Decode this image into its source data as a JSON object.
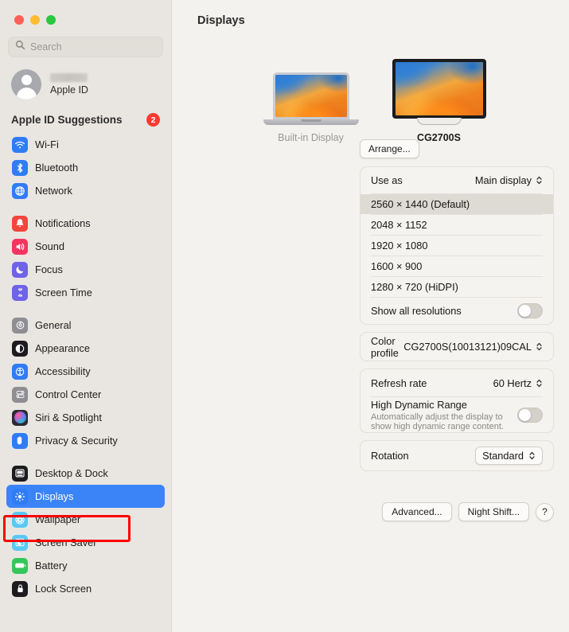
{
  "window": {
    "traffic_lights": [
      "close",
      "minimize",
      "zoom"
    ]
  },
  "sidebar": {
    "search": {
      "placeholder": "Search",
      "value": ""
    },
    "account": {
      "name_redacted": true,
      "subtitle": "Apple ID"
    },
    "suggestions": {
      "title": "Apple ID Suggestions",
      "badge": "2"
    },
    "groups": [
      {
        "items": [
          {
            "label": "Wi-Fi",
            "icon": "wifi-icon",
            "color": "#2f7cf6"
          },
          {
            "label": "Bluetooth",
            "icon": "bluetooth-icon",
            "color": "#2f7cf6"
          },
          {
            "label": "Network",
            "icon": "network-globe-icon",
            "color": "#2f7cf6"
          }
        ]
      },
      {
        "items": [
          {
            "label": "Notifications",
            "icon": "notifications-bell-icon",
            "color": "#f4453c"
          },
          {
            "label": "Sound",
            "icon": "sound-speaker-icon",
            "color": "#f5355f"
          },
          {
            "label": "Focus",
            "icon": "focus-moon-icon",
            "color": "#6f63e8"
          },
          {
            "label": "Screen Time",
            "icon": "screen-time-hourglass-icon",
            "color": "#6f63e8"
          }
        ]
      },
      {
        "items": [
          {
            "label": "General",
            "icon": "general-gear-icon",
            "color": "#8e8e93"
          },
          {
            "label": "Appearance",
            "icon": "appearance-contrast-icon",
            "color": "#1c1c1e"
          },
          {
            "label": "Accessibility",
            "icon": "accessibility-person-icon",
            "color": "#2f7cf6"
          },
          {
            "label": "Control Center",
            "icon": "control-center-icon",
            "color": "#8e8e93"
          },
          {
            "label": "Siri & Spotlight",
            "icon": "siri-orb-icon",
            "color": "#2b2b33"
          },
          {
            "label": "Privacy & Security",
            "icon": "privacy-hand-icon",
            "color": "#2f7cf6"
          }
        ]
      },
      {
        "items": [
          {
            "label": "Desktop & Dock",
            "icon": "desktop-dock-icon",
            "color": "#1c1c1e"
          },
          {
            "label": "Displays",
            "icon": "displays-brightness-icon",
            "color": "#2f7cf6",
            "selected": true
          },
          {
            "label": "Wallpaper",
            "icon": "wallpaper-flower-icon",
            "color": "#5ac8f5"
          },
          {
            "label": "Screen Saver",
            "icon": "screen-saver-icon",
            "color": "#5ac8f5"
          },
          {
            "label": "Battery",
            "icon": "battery-icon",
            "color": "#34c759"
          },
          {
            "label": "Lock Screen",
            "icon": "lock-screen-icon",
            "color": "#1c1c1e"
          }
        ]
      }
    ]
  },
  "main": {
    "title": "Displays",
    "arrange_button": "Arrange...",
    "displays": [
      {
        "name": "Built-in Display",
        "type": "laptop",
        "selected": false
      },
      {
        "name": "CG2700S",
        "type": "monitor",
        "selected": true
      }
    ],
    "use_as": {
      "label": "Use as",
      "value": "Main display"
    },
    "resolutions": [
      {
        "label": "2560 × 1440 (Default)",
        "selected": true
      },
      {
        "label": "2048 × 1152",
        "selected": false
      },
      {
        "label": "1920 × 1080",
        "selected": false
      },
      {
        "label": "1600 × 900",
        "selected": false
      },
      {
        "label": "1280 × 720 (HiDPI)",
        "selected": false
      }
    ],
    "show_all_resolutions": {
      "label": "Show all resolutions",
      "enabled": false
    },
    "color_profile": {
      "label": "Color profile",
      "value": "CG2700S(10013121)09CAL"
    },
    "refresh_rate": {
      "label": "Refresh rate",
      "value": "60 Hertz"
    },
    "hdr": {
      "label": "High Dynamic Range",
      "description": "Automatically adjust the display to show high dynamic range content.",
      "enabled": false
    },
    "rotation": {
      "label": "Rotation",
      "value": "Standard"
    },
    "buttons": {
      "advanced": "Advanced...",
      "night_shift": "Night Shift...",
      "help": "?"
    }
  },
  "annotation": {
    "color": "#fe0000",
    "target": "Displays"
  }
}
